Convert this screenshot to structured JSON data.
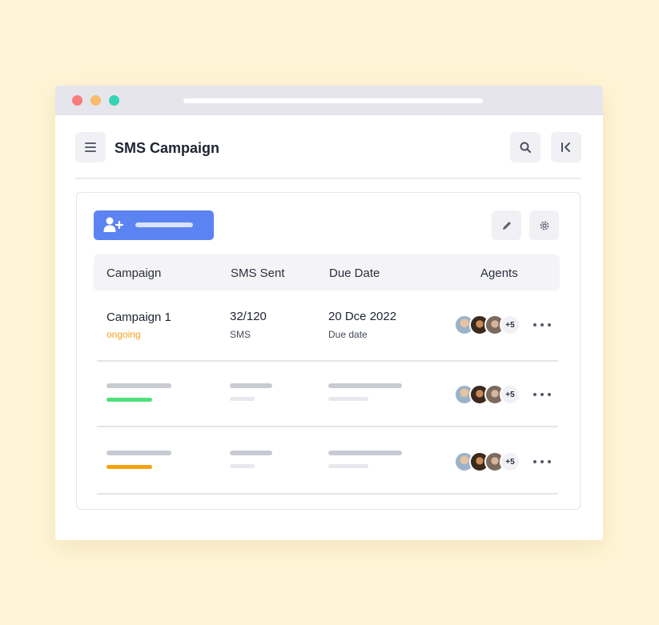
{
  "window": {
    "colors": {
      "close": "#f87c7c",
      "minimize": "#f7bb6a",
      "maximize": "#36d3b4"
    }
  },
  "header": {
    "title": "SMS Campaign",
    "menu_icon": "hamburger-icon",
    "search_icon": "search-icon",
    "collapse_icon": "collapse-left-icon"
  },
  "toolbar": {
    "add_icon": "add-user-icon",
    "edit_icon": "pencil-icon",
    "settings_icon": "gear-icon",
    "accent": "#5b83f1"
  },
  "table": {
    "columns": [
      "Campaign",
      "SMS Sent",
      "Due Date",
      "Agents"
    ],
    "rows": [
      {
        "campaign": "Campaign 1",
        "status": "ongoing",
        "sent": "32/120",
        "sent_unit": "SMS",
        "due": "20 Dce 2022",
        "due_label": "Due date",
        "agents_more": "+5"
      },
      {
        "status_color": "#4ee07a",
        "agents_more": "+5"
      },
      {
        "status_color": "#f7a10c",
        "agents_more": "+5"
      }
    ]
  },
  "status_colors": {
    "ongoing": "#f4a321"
  }
}
